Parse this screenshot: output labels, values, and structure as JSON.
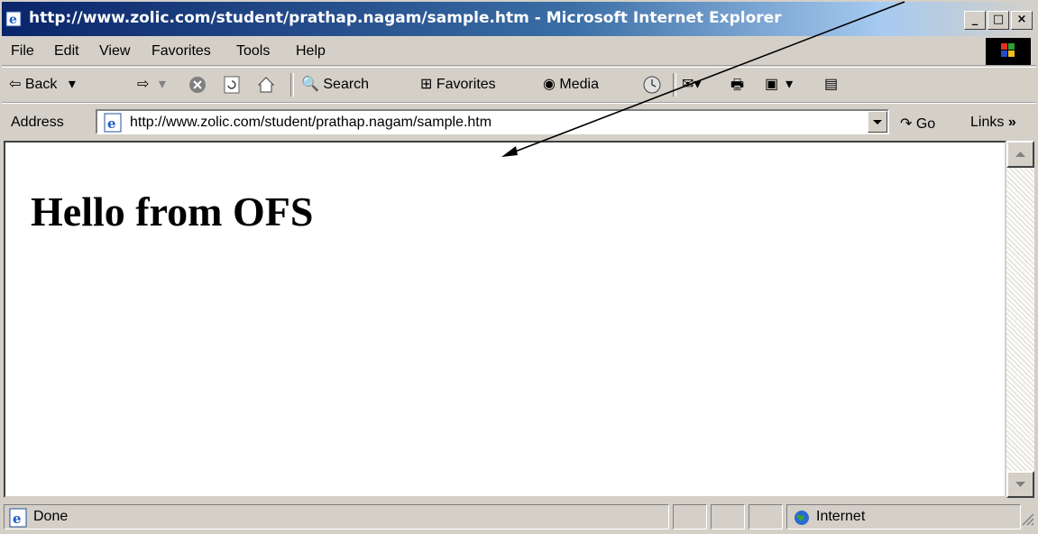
{
  "window": {
    "title": "http://www.zolic.com/student/prathap.nagam/sample.htm - Microsoft Internet Explorer",
    "minimize": "_",
    "maximize": "□",
    "close": "×"
  },
  "menu": {
    "file": "File",
    "edit": "Edit",
    "view": "View",
    "favorites": "Favorites",
    "tools": "Tools",
    "help": "Help"
  },
  "toolbar": {
    "back": "Back",
    "search": "Search",
    "favorites": "Favorites",
    "media": "Media"
  },
  "address": {
    "label": "Address",
    "url": "http://www.zolic.com/student/prathap.nagam/sample.htm",
    "go": "Go",
    "links": "Links",
    "links_chevron": "»"
  },
  "page": {
    "heading": "Hello from OFS"
  },
  "status": {
    "text": "Done",
    "zone": "Internet"
  }
}
